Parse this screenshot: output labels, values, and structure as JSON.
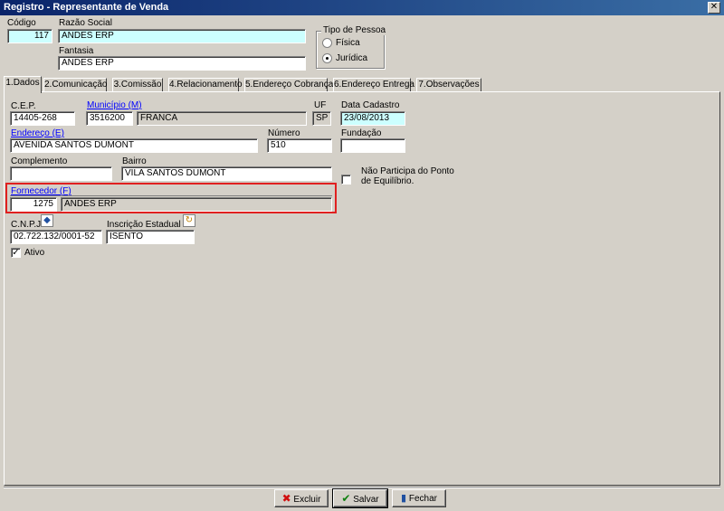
{
  "window": {
    "title": "Registro - Representante de Venda",
    "close_glyph": "✕"
  },
  "header": {
    "codigo_label": "Código",
    "codigo_value": "117",
    "razao_label": "Razão Social",
    "razao_value": "ANDES ERP",
    "fantasia_label": "Fantasia",
    "fantasia_value": "ANDES ERP",
    "tipo_pessoa": {
      "title": "Tipo de Pessoa",
      "options": [
        "Física",
        "Jurídica"
      ],
      "selected": "Jurídica"
    }
  },
  "tabs": [
    {
      "label": "1.Dados"
    },
    {
      "label": "2.Comunicação"
    },
    {
      "label": "3.Comissão"
    },
    {
      "label": "4.Relacionamento"
    },
    {
      "label": "5.Endereço Cobrança"
    },
    {
      "label": "6.Endereço Entrega"
    },
    {
      "label": "7.Observações"
    }
  ],
  "dados": {
    "cep_label": "C.E.P.",
    "cep_value": "14405-268",
    "municipio_label": "Município (M)",
    "municipio_code": "3516200",
    "municipio_name": "FRANCA",
    "uf_label": "UF",
    "uf_value": "SP",
    "data_cadastro_label": "Data Cadastro",
    "data_cadastro_value": "23/08/2013",
    "endereco_label": "Endereço (E)",
    "endereco_value": "AVENIDA SANTOS DUMONT",
    "numero_label": "Número",
    "numero_value": "510",
    "fundacao_label": "Fundação",
    "fundacao_value": "",
    "complemento_label": "Complemento",
    "complemento_value": "",
    "bairro_label": "Bairro",
    "bairro_value": "VILA SANTOS DUMONT",
    "nao_participa_label_1": "Não Participa do Ponto",
    "nao_participa_label_2": "de Equilíbrio.",
    "fornecedor_label": "Fornecedor (F)",
    "fornecedor_code": "1275",
    "fornecedor_name": "ANDES ERP",
    "cnpj_label": "C.N.P.J.",
    "cnpj_value": "02.722.132/0001-52",
    "ie_label": "Inscrição Estadual",
    "ie_value": "ISENTO",
    "ativo_label": "Ativo",
    "ativo_checked": true
  },
  "buttons": {
    "excluir": "Excluir",
    "salvar": "Salvar",
    "fechar": "Fechar"
  },
  "colors": {
    "titlebar_start": "#0a246a",
    "titlebar_end": "#3a6ea5",
    "highlight_border": "#e02020",
    "field_cyan": "#ccffff"
  }
}
